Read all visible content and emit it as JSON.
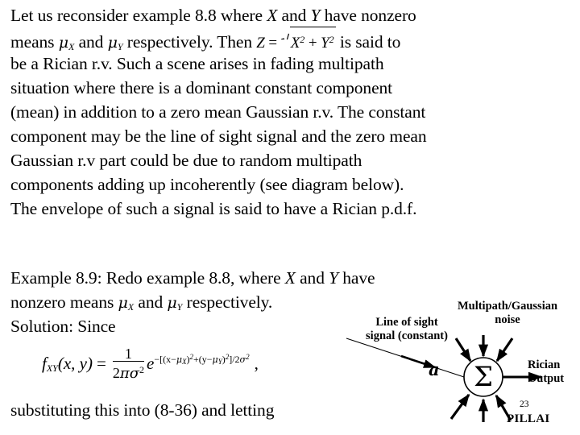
{
  "slide": {
    "page_number": "23",
    "footer": "PILLAI",
    "background_color": "#ffffff",
    "text_color": "#000000"
  },
  "paragraph1": {
    "lines": [
      "Let us reconsider example 8.8 where X and Y have nonzero",
      "means μX and μY  respectively. Then Z = √(X² + Y²)  is said to",
      "be a Rician r.v. Such a scene arises in fading multipath",
      "situation where there is a dominant constant component",
      "(mean) in addition to a zero mean Gaussian r.v. The constant",
      "component may be the line of sight signal and the zero mean",
      "Gaussian r.v part could be due to random multipath",
      "components adding up incoherently (see diagram below).",
      "The envelope of such a signal is said to have a Rician p.d.f."
    ],
    "line1_part1": "Let us reconsider example 8.8 where ",
    "line1_var_x": "X",
    "line1_part2": " and ",
    "line1_var_y": "Y",
    "line1_part3": " have nonzero",
    "line2_part1": "means ",
    "line2_mu_x": "μ",
    "line2_mu_x_sub": "X",
    "line2_part2": " and ",
    "line2_mu_y": "μ",
    "line2_mu_y_sub": "Y",
    "line2_part3": "  respectively. Then ",
    "line2_z": "Z",
    "line2_eq": " = ",
    "line2_rad_x": "X",
    "line2_rad_plus": " + ",
    "line2_rad_y": "Y",
    "line2_sup": "2",
    "line2_part4": "  is said to",
    "line3": "be a Rician r.v. Such a scene arises in fading multipath",
    "line4": "situation where there is a dominant constant component",
    "line5": "(mean) in addition to a zero mean Gaussian r.v. The constant",
    "line6": "component may be the line of sight signal and the zero mean",
    "line7": "Gaussian r.v part could be due to random multipath",
    "line8": "components adding up incoherently (see diagram below).",
    "line9": "The envelope of such a signal is said to have a Rician p.d.f."
  },
  "paragraph2": {
    "line1_part1": "Example 8.9: Redo example 8.8, where ",
    "line1_var_x": "X",
    "line1_part2": " and ",
    "line1_var_y": "Y",
    "line1_part3": " have",
    "line2_part1": "nonzero means ",
    "line2_mu_x": "μ",
    "line2_mu_x_sub": "X",
    "line2_part2": " and ",
    "line2_mu_y": "μ",
    "line2_mu_y_sub": "Y",
    "line2_part3": " respectively.",
    "line3": "Solution: Since",
    "closing_line": "substituting this into (8-36) and letting"
  },
  "formula": {
    "lhs_f": "f",
    "lhs_sub": "XY",
    "lhs_args": "(x, y)",
    "equals": "=",
    "frac_num": "1",
    "frac_den_two": "2",
    "frac_den_pi": "π",
    "frac_den_sigma": "σ",
    "frac_den_sigma_exp": "2",
    "exp_base": "e",
    "exp_open": "−[(x−",
    "exp_mu1": "μ",
    "exp_mu1_sub": "X",
    "exp_mid": ")",
    "exp_sq": "2",
    "exp_plus": "+(y−",
    "exp_mu2": "μ",
    "exp_mu2_sub": "Y",
    "exp_close": ")",
    "exp_sq2": "2",
    "exp_tail": "]/2",
    "exp_sigma": "σ",
    "exp_sigma_sq": "2",
    "trailing_comma": ","
  },
  "diagram": {
    "sum_symbol": "Σ",
    "label_multipath_line1": "Multipath/Gaussian",
    "label_multipath_line2": "noise",
    "label_los_line1": "Line of sight",
    "label_los_line2": "signal (constant)",
    "label_amplitude": "a",
    "label_output_line1": "Rician",
    "label_output_line2": "Output",
    "stroke_color": "#000000",
    "noise_arrow_count": 6
  }
}
